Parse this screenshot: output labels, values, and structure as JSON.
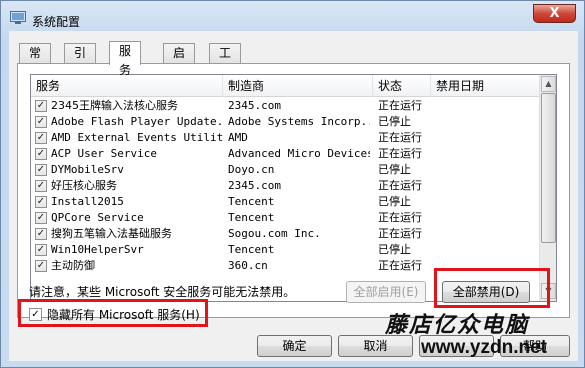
{
  "window": {
    "title": "系统配置",
    "close_label": "X"
  },
  "tabs": [
    {
      "label": "常规"
    },
    {
      "label": "引导"
    },
    {
      "label": "服务"
    },
    {
      "label": "启动"
    },
    {
      "label": "工具"
    }
  ],
  "table": {
    "columns": [
      "服务",
      "制造商",
      "状态",
      "禁用日期"
    ],
    "rows": [
      {
        "service": "2345王牌输入法核心服务",
        "maker": "2345.com",
        "status": "正在运行"
      },
      {
        "service": "Adobe Flash Player Update...",
        "maker": "Adobe Systems Incorp...",
        "status": "已停止"
      },
      {
        "service": "AMD External Events Utility",
        "maker": "AMD",
        "status": "正在运行"
      },
      {
        "service": "ACP User Service",
        "maker": "Advanced Micro Devices",
        "status": "正在运行"
      },
      {
        "service": "DYMobileSrv",
        "maker": "Doyo.cn",
        "status": "已停止"
      },
      {
        "service": "好压核心服务",
        "maker": "2345.com",
        "status": "正在运行"
      },
      {
        "service": "Install2015",
        "maker": "Tencent",
        "status": "已停止"
      },
      {
        "service": "QPCore Service",
        "maker": "Tencent",
        "status": "正在运行"
      },
      {
        "service": "搜狗五笔输入法基础服务",
        "maker": "Sogou.com Inc.",
        "status": "正在运行"
      },
      {
        "service": "Win10HelperSvr",
        "maker": "Tencent",
        "status": "已停止"
      },
      {
        "service": "主动防御",
        "maker": "360.cn",
        "status": "正在运行"
      }
    ]
  },
  "note": "请注意，某些 Microsoft 安全服务可能无法禁用。",
  "buttons": {
    "enable_all": "全部启用(E)",
    "disable_all": "全部禁用(D)",
    "ok": "确定",
    "cancel": "取消",
    "help": "帮助"
  },
  "hide_ms": {
    "label": "隐藏所有 Microsoft 服务(H)",
    "checked": true
  },
  "watermark": {
    "cn": "藤店亿众电脑",
    "url": "www.yzdn.net"
  },
  "colors": {
    "highlight": "#e0141b"
  }
}
